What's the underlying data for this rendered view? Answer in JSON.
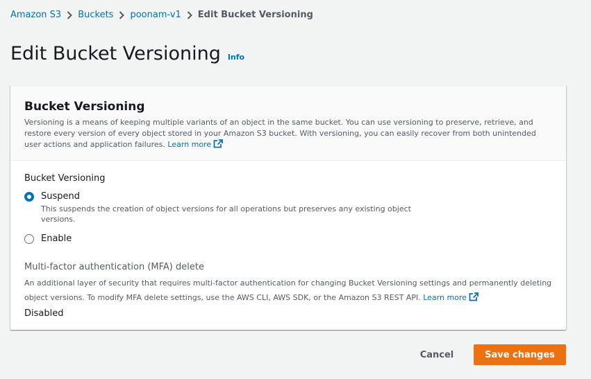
{
  "breadcrumb": {
    "items": [
      "Amazon S3",
      "Buckets",
      "poonam-v1"
    ],
    "current": "Edit Bucket Versioning"
  },
  "page": {
    "title": "Edit Bucket Versioning",
    "info_label": "Info"
  },
  "panel": {
    "title": "Bucket Versioning",
    "description": "Versioning is a means of keeping multiple variants of an object in the same bucket. You can use versioning to preserve, retrieve, and restore every version of every object stored in your Amazon S3 bucket. With versioning, you can easily recover from both unintended user actions and application failures.",
    "learn_more": "Learn more"
  },
  "versioning": {
    "label": "Bucket Versioning",
    "selected": "suspend",
    "options": [
      {
        "id": "suspend",
        "label": "Suspend",
        "description": "This suspends the creation of object versions for all operations but preserves any existing object versions."
      },
      {
        "id": "enable",
        "label": "Enable",
        "description": ""
      }
    ]
  },
  "mfa": {
    "label": "Multi-factor authentication (MFA) delete",
    "description": "An additional layer of security that requires multi-factor authentication for changing Bucket Versioning settings and permanently deleting object versions. To modify MFA delete settings, use the AWS CLI, AWS SDK, or the Amazon S3 REST API.",
    "learn_more": "Learn more",
    "value": "Disabled"
  },
  "actions": {
    "cancel_label": "Cancel",
    "save_label": "Save changes"
  },
  "colors": {
    "link": "#0073bb",
    "primary_button": "#ec7211",
    "background": "#f2f3f3"
  },
  "icons": {
    "breadcrumb_separator": "chevron-right-icon",
    "learn_more": "external-link-icon"
  }
}
